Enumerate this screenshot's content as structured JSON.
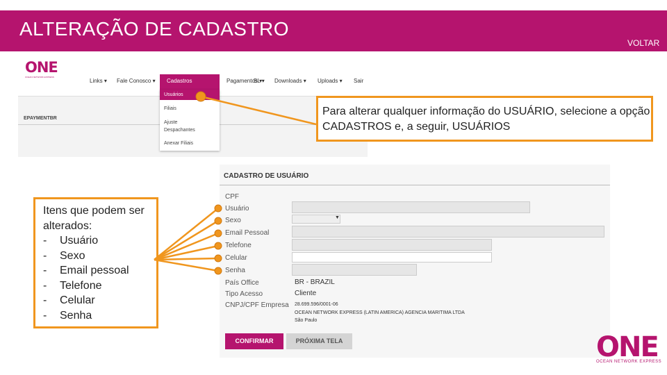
{
  "header": {
    "title": "ALTERAÇÃO DE CADASTRO",
    "back_label": "VOLTAR"
  },
  "colors": {
    "brand": "#b5146e",
    "callout_border": "#f0961e"
  },
  "top_screenshot": {
    "logo": "ONE",
    "logo_sub": "OCEAN NETWORK EXPRESS",
    "nav": [
      "Links",
      "Fale Conosco",
      "Cadastros",
      "Pagamentos",
      "BL",
      "Downloads",
      "Uploads",
      "Sair"
    ],
    "dropdown": [
      "Usuários",
      "Filiais",
      "Ajuste Despachantes",
      "Anexar Filiais"
    ],
    "section": "EPAYMENTBR"
  },
  "callout_top": "Para alterar qualquer informação do USUÁRIO, selecione a opção CADASTROS e, a seguir, USUÁRIOS",
  "callout_left": {
    "intro": "Itens que podem ser alterados:",
    "items": [
      "Usuário",
      "Sexo",
      "Email pessoal",
      "Telefone",
      "Celular",
      "Senha"
    ]
  },
  "form": {
    "title": "CADASTRO DE USUÁRIO",
    "labels": [
      "CPF",
      "Usuário",
      "Sexo",
      "Email Pessoal",
      "Telefone",
      "Celular",
      "Senha",
      "País Office",
      "Tipo Acesso",
      "CNPJ/CPF Empresa"
    ],
    "pais_office": "BR - BRAZIL",
    "tipo_acesso": "Cliente",
    "cnpj": "28.699.596/0001-06",
    "empresa": "OCEAN NETWORK EXPRESS (LATIN AMERICA) AGENCIA MARITIMA LTDA",
    "cidade": "São Paulo",
    "confirm_label": "CONFIRMAR",
    "next_label": "PRÓXIMA TELA"
  },
  "brand": {
    "logo": "ONE",
    "tagline": "OCEAN NETWORK EXPRESS"
  }
}
